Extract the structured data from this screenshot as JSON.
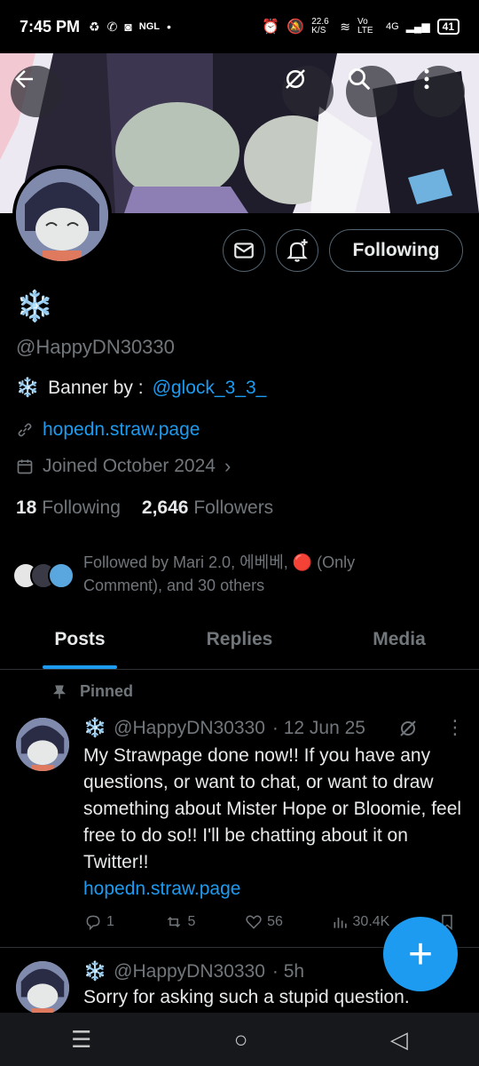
{
  "status": {
    "time": "7:45 PM",
    "left_icons": [
      "recycle-icon",
      "whatsapp-icon",
      "discord-icon",
      "NGL",
      "•"
    ],
    "net_speed": "22.6\nK/S",
    "lte": "Vo LTE",
    "signal": "4G",
    "battery": "41"
  },
  "header": {
    "back_icon": "back-arrow-icon",
    "buttons": [
      "grok-icon",
      "search-icon",
      "more-vertical-icon"
    ]
  },
  "profile": {
    "display_name": "❄️",
    "handle": "@HappyDN30330",
    "bio_emoji": "❄️",
    "bio_text": "Banner by :",
    "bio_mention": "@glock_3_3_",
    "link": "hopedn.straw.page",
    "joined": "Joined October 2024",
    "following_count": "18",
    "following_label": "Following",
    "followers_count": "2,646",
    "followers_label": "Followers",
    "followed_by": "Followed by Mari 2.0, 에베베, 🔴 (Only Comment), and 30 others",
    "follow_button": "Following"
  },
  "tabs": [
    {
      "label": "Posts",
      "active": true
    },
    {
      "label": "Replies",
      "active": false
    },
    {
      "label": "Media",
      "active": false
    }
  ],
  "pinned_label": "Pinned",
  "tweets": [
    {
      "emoji": "❄️",
      "handle": "@HappyDN30330",
      "time": "· 12 Jun 25",
      "text": "My Strawpage done now!! If you have any questions, or want to chat, or want to draw something about Mister Hope or Bloomie, feel free to do so!! I'll be chatting about it on Twitter!!",
      "link": "hopedn.straw.page",
      "replies": "1",
      "reposts": "5",
      "likes": "56",
      "views": "30.4K"
    },
    {
      "emoji": "❄️",
      "handle": "@HappyDN30330",
      "time": "· 5h",
      "text": "Sorry for asking such a stupid question."
    }
  ],
  "fab_label": "+",
  "colors": {
    "accent": "#1d9bf0",
    "muted": "#71767b",
    "text": "#e7e9ea",
    "background": "#000000"
  }
}
